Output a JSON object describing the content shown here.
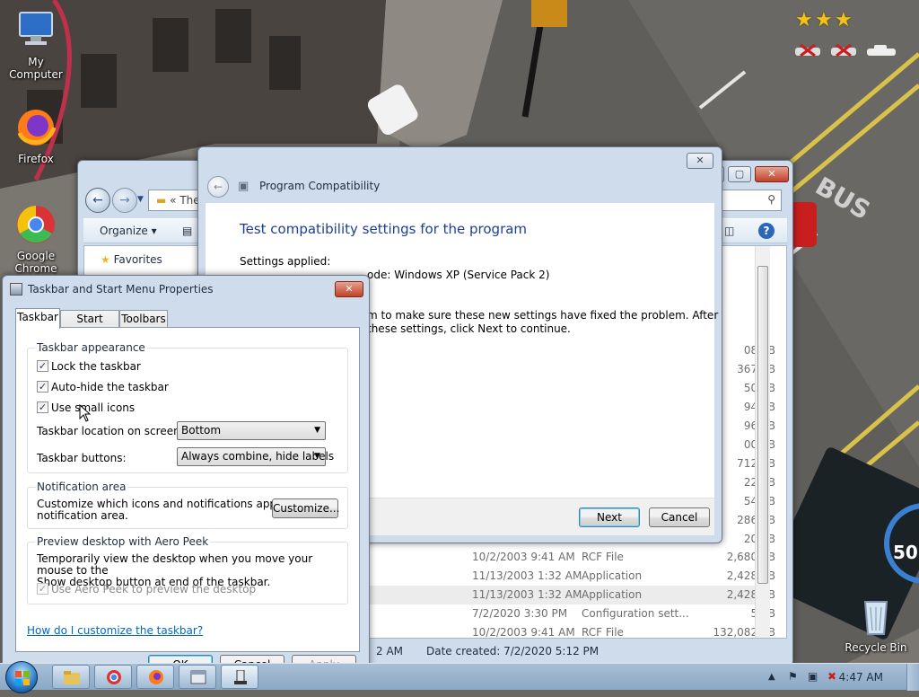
{
  "desktop": {
    "icons": [
      {
        "label": "My Computer",
        "icon": "computer-icon"
      },
      {
        "label": "Firefox",
        "icon": "firefox-icon"
      },
      {
        "label": "Google Chrome",
        "icon": "chrome-icon"
      },
      {
        "label": "Recycle Bin",
        "icon": "recycle-bin-icon"
      }
    ]
  },
  "explorer": {
    "address": "«   The",
    "search_placeholder": "n",
    "cmd_organize": "Organize",
    "nav_favorites": "Favorites",
    "sizes_partial": [
      "08 KB",
      "367 KB",
      "50 KB",
      "94 KB",
      "96 KB",
      "00 KB",
      "712 KB",
      "22 KB",
      "54 KB",
      "286 KB",
      "20 KB"
    ],
    "rows": [
      {
        "date": "10/2/2003 9:41 AM",
        "type": "RCF File",
        "size": "2,680 KB",
        "selected": false
      },
      {
        "date": "11/13/2003 1:32 AM",
        "type": "Application",
        "size": "2,428 KB",
        "selected": false
      },
      {
        "date": "11/13/2003 1:32 AM",
        "type": "Application",
        "size": "2,428 KB",
        "selected": true
      },
      {
        "date": "7/2/2020 3:30 PM",
        "type": "Configuration sett...",
        "size": "5 KB",
        "selected": false
      },
      {
        "date": "10/2/2003 9:41 AM",
        "type": "RCF File",
        "size": "132,082 KB",
        "selected": false
      }
    ],
    "status_left": "2 AM",
    "status_created": "Date created: 7/2/2020 5:12 PM"
  },
  "compat": {
    "title": "Program Compatibility",
    "heading": "Test compatibility settings for the program",
    "settings_applied": "Settings applied:",
    "mode_line": "ode: Windows XP (Service Pack 2)",
    "instruction_1": "m to make sure these new settings have fixed the problem. After",
    "instruction_2": "these settings, click Next to continue.",
    "next": "Next",
    "cancel": "Cancel"
  },
  "props": {
    "title": "Taskbar and Start Menu Properties",
    "tabs": [
      "Taskbar",
      "Start Menu",
      "Toolbars"
    ],
    "appearance": {
      "label": "Taskbar appearance",
      "lock": "Lock the taskbar",
      "autohide": "Auto-hide the taskbar",
      "small_icons": "Use small icons",
      "location_label": "Taskbar location on screen:",
      "location_value": "Bottom",
      "buttons_label": "Taskbar buttons:",
      "buttons_value": "Always combine, hide labels"
    },
    "notification": {
      "label": "Notification area",
      "text_1": "Customize which icons and notifications appear in the",
      "text_2": "notification area.",
      "customize": "Customize..."
    },
    "peek": {
      "label": "Preview desktop with Aero Peek",
      "text_1": "Temporarily view the desktop when you move your mouse to the",
      "text_2": "Show desktop button at end of the taskbar.",
      "use_peek": "Use Aero Peek to preview the desktop"
    },
    "help_link": "How do I customize the taskbar?",
    "ok": "OK",
    "cancel": "Cancel",
    "apply": "Apply"
  },
  "taskbar": {
    "clock": "4:47 AM",
    "tray_expand": "▲"
  }
}
